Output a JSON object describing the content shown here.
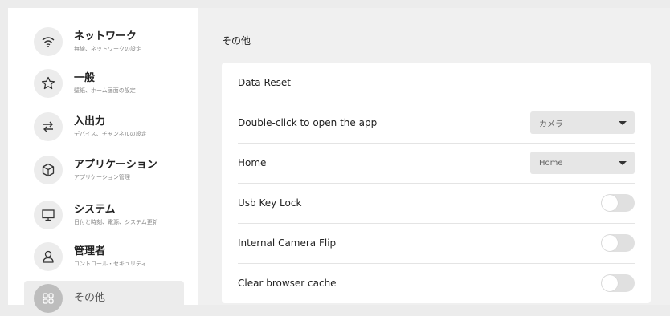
{
  "sidebar": {
    "items": [
      {
        "icon": "wifi-icon",
        "title": "ネットワーク",
        "subtitle": "無線、ネットワークの設定"
      },
      {
        "icon": "star-icon",
        "title": "一般",
        "subtitle": "壁紙、ホーム画面の設定"
      },
      {
        "icon": "swap-arrows-icon",
        "title": "入出力",
        "subtitle": "デバイス、チャンネルの設定"
      },
      {
        "icon": "cube-icon",
        "title": "アプリケーション",
        "subtitle": "アプリケーション管理"
      },
      {
        "icon": "monitor-icon",
        "title": "システム",
        "subtitle": "日付と時刻、電源、システム更新"
      },
      {
        "icon": "user-icon",
        "title": "管理者",
        "subtitle": "コントロール・セキュリティ"
      },
      {
        "icon": "grid-icon",
        "title": "その他",
        "subtitle": ""
      }
    ],
    "active_index": 6
  },
  "main": {
    "section_title": "その他",
    "rows": [
      {
        "label": "Data Reset",
        "control": "none"
      },
      {
        "label": "Double-click to open the app",
        "control": "select",
        "value": "カメラ"
      },
      {
        "label": "Home",
        "control": "select",
        "value": "Home"
      },
      {
        "label": "Usb Key Lock",
        "control": "toggle",
        "on": false
      },
      {
        "label": "Internal Camera Flip",
        "control": "toggle",
        "on": false
      },
      {
        "label": "Clear browser cache",
        "control": "toggle",
        "on": false
      }
    ]
  },
  "colors": {
    "background": "#f0f0f0",
    "panel": "#ffffff",
    "toggle_off": "#e0e0e0",
    "active_nav": "#ececec"
  }
}
